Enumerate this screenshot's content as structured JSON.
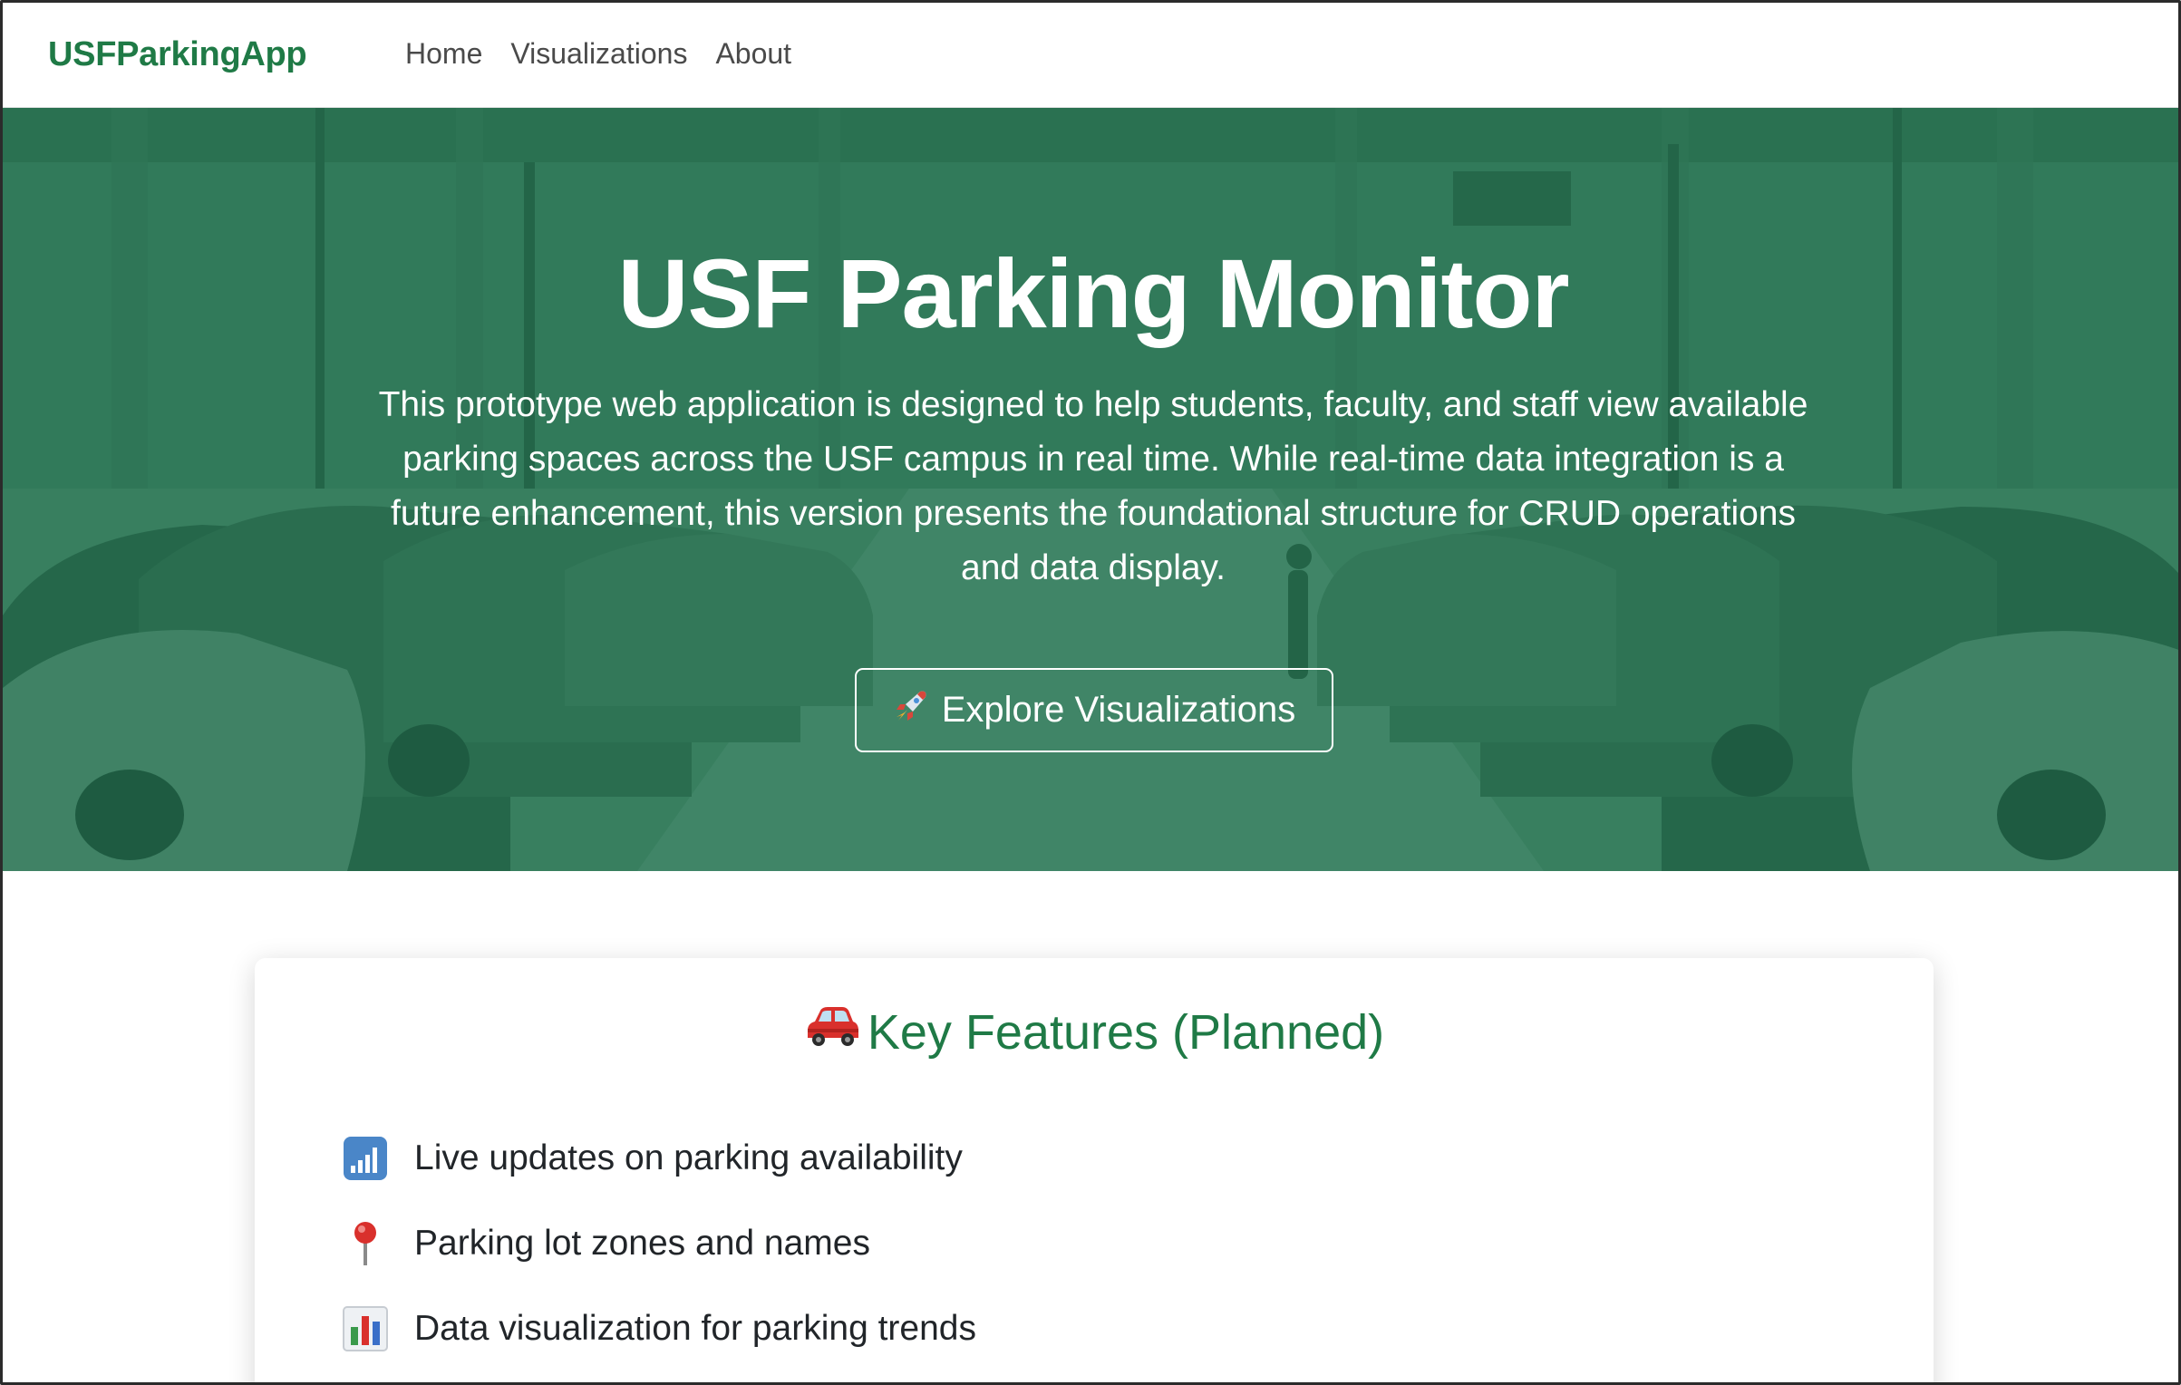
{
  "navbar": {
    "brand": "USFParkingApp",
    "links": [
      "Home",
      "Visualizations",
      "About"
    ]
  },
  "hero": {
    "title": "USF Parking Monitor",
    "description": "This prototype web application is designed to help students, faculty, and staff view available parking spaces across the USF campus in real time. While real-time data integration is a future enhancement, this version presents the foundational structure for CRUD operations and data display.",
    "button_label": "Explore Visualizations",
    "button_icon": "rocket-icon",
    "background_image": "parking-lot-cars-photo"
  },
  "features": {
    "title": "Key Features (Planned)",
    "title_icon": "red-car-icon",
    "items": [
      {
        "icon": "signal-bars-icon",
        "label": "Live updates on parking availability"
      },
      {
        "icon": "pushpin-icon",
        "label": "Parking lot zones and names"
      },
      {
        "icon": "bar-chart-icon",
        "label": "Data visualization for parking trends"
      }
    ]
  },
  "colors": {
    "brand_green": "#1f7a46",
    "hero_overlay": "#1e6e4b",
    "text_dark": "#212529",
    "nav_text": "#4a4a4a"
  }
}
